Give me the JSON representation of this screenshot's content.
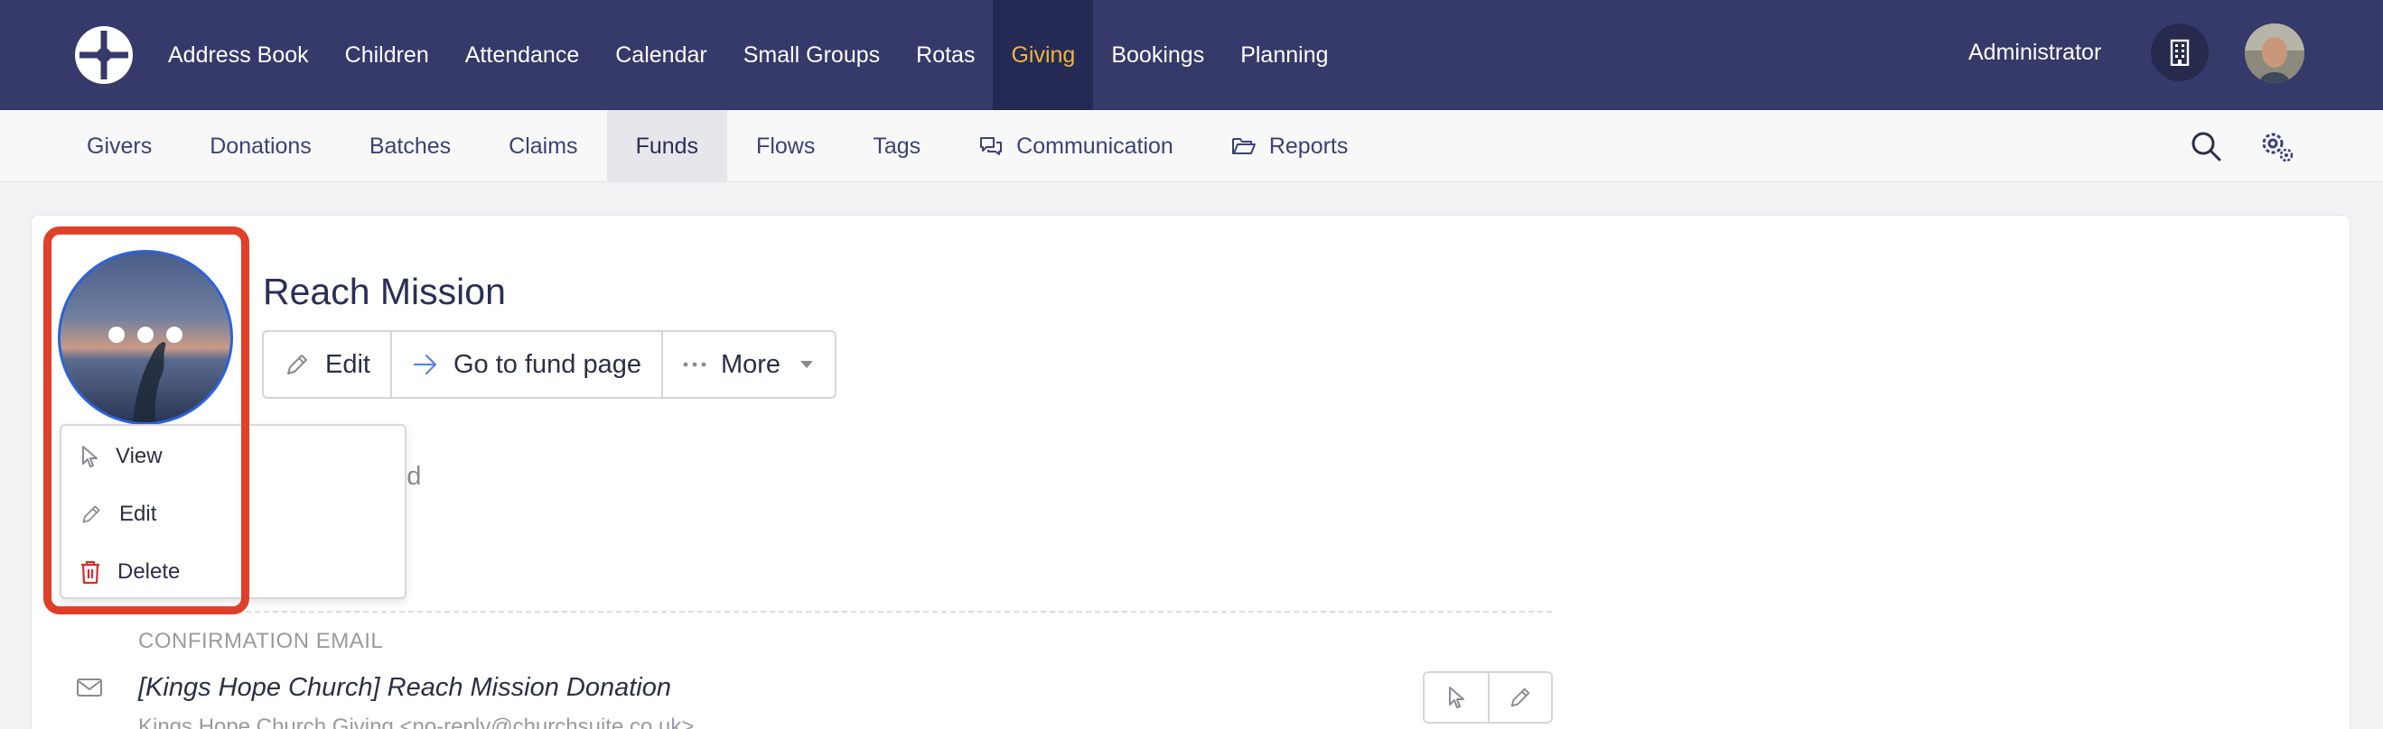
{
  "topnav": {
    "items": [
      "Address Book",
      "Children",
      "Attendance",
      "Calendar",
      "Small Groups",
      "Rotas",
      "Giving",
      "Bookings",
      "Planning"
    ],
    "active": "Giving",
    "user_label": "Administrator",
    "active_color": "#f0b43c",
    "background": "#353a6a"
  },
  "subnav": {
    "items": [
      "Givers",
      "Donations",
      "Batches",
      "Claims",
      "Funds",
      "Flows",
      "Tags",
      "Communication",
      "Reports"
    ],
    "active": "Funds"
  },
  "fund": {
    "title": "Reach Mission",
    "actions": {
      "edit": "Edit",
      "goto": "Go to fund page",
      "more": "More"
    },
    "partial_text": "und"
  },
  "image_menu": {
    "view": "View",
    "edit": "Edit",
    "delete": "Delete"
  },
  "confirmation": {
    "label": "CONFIRMATION EMAIL",
    "subject": "[Kings Hope Church] Reach Mission Donation",
    "from": "Kings Hope Church Giving <no-reply@churchsuite.co.uk>"
  },
  "colors": {
    "highlight": "#e0402a",
    "delete": "#d22f2f",
    "image_border": "#2f62d8"
  }
}
